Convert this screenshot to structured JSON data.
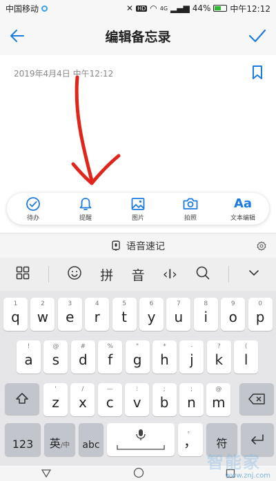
{
  "status": {
    "carrier": "中国移动",
    "network": "4G",
    "battery": "44%",
    "time": "中午12:12"
  },
  "header": {
    "title": "编辑备忘录"
  },
  "note": {
    "date": "2019年4月4日 中午12:12"
  },
  "toolbar": {
    "items": [
      {
        "label": "待办",
        "icon": "check-circle-icon"
      },
      {
        "label": "提醒",
        "icon": "bell-icon"
      },
      {
        "label": "图片",
        "icon": "image-icon"
      },
      {
        "label": "拍照",
        "icon": "camera-icon"
      },
      {
        "label": "文本编辑",
        "icon": "text-format-icon",
        "glyph": "Aa"
      }
    ]
  },
  "voice": {
    "label": "语音速记"
  },
  "keyboard_top": {
    "pinyin": "拼",
    "sound": "音",
    "cursor": "‹I›"
  },
  "keyboard": {
    "row1": [
      {
        "main": "q",
        "sup": "1"
      },
      {
        "main": "w",
        "sup": "2"
      },
      {
        "main": "e",
        "sup": "3"
      },
      {
        "main": "r",
        "sup": "4"
      },
      {
        "main": "t",
        "sup": "5"
      },
      {
        "main": "y",
        "sup": "6"
      },
      {
        "main": "u",
        "sup": "7"
      },
      {
        "main": "i",
        "sup": "8"
      },
      {
        "main": "o",
        "sup": "9"
      },
      {
        "main": "p",
        "sup": "0"
      }
    ],
    "row2": [
      {
        "main": "a",
        "sup": "!"
      },
      {
        "main": "s",
        "sup": "@"
      },
      {
        "main": "d",
        "sup": "#"
      },
      {
        "main": "f",
        "sup": "%"
      },
      {
        "main": "g",
        "sup": "\""
      },
      {
        "main": "h",
        "sup": "*"
      },
      {
        "main": "j",
        "sup": "-"
      },
      {
        "main": "k",
        "sup": "?"
      },
      {
        "main": "l",
        "sup": "("
      }
    ],
    "row3": [
      {
        "main": "z",
        "sup": "'"
      },
      {
        "main": "x",
        "sup": "/"
      },
      {
        "main": "c",
        "sup": "—"
      },
      {
        "main": "v",
        "sup": ":"
      },
      {
        "main": "b",
        "sup": ";"
      },
      {
        "main": "n",
        "sup": ";"
      },
      {
        "main": "m",
        "sup": "@"
      }
    ],
    "num": "123",
    "lang": "英",
    "lang_sub": "/中",
    "abc": "abc",
    "punct": "，",
    "punct_sup": "。",
    "symbol": "符"
  },
  "watermark": {
    "big": "智能家",
    "url": "www.znj.com"
  },
  "colors": {
    "accent": "#1c7ae3",
    "arrow": "#e0251b"
  }
}
